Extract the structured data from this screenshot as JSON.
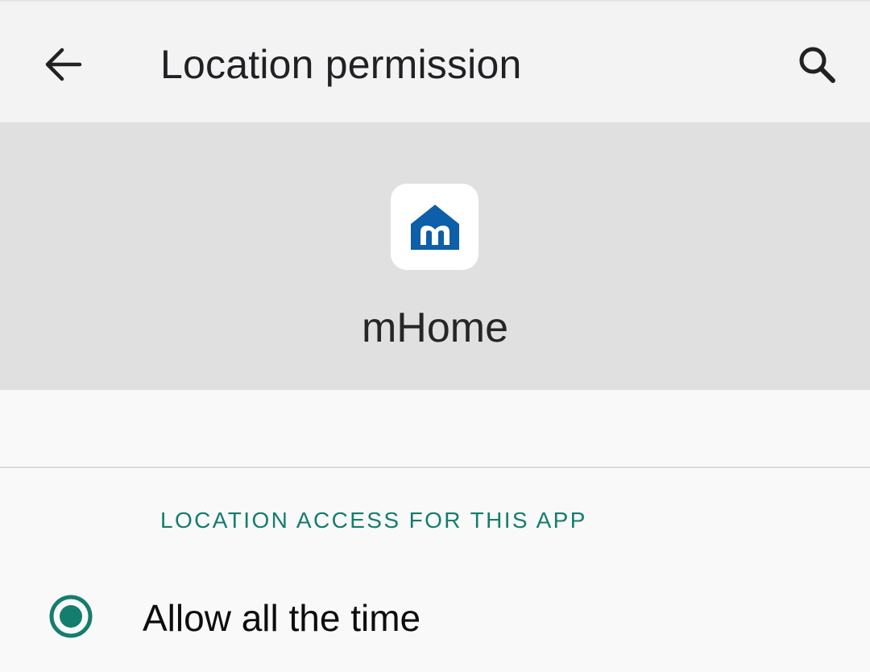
{
  "app_bar": {
    "back_icon": "arrow-back-icon",
    "title": "Location permission",
    "search_icon": "search-icon"
  },
  "app_header": {
    "icon": "mhome-logo-icon",
    "app_name": "mHome",
    "icon_color": "#0c5fa8"
  },
  "section": {
    "header": "LOCATION ACCESS FOR THIS APP"
  },
  "options": [
    {
      "label": "Allow all the time",
      "selected": true
    }
  ],
  "colors": {
    "accent": "#147d6e"
  }
}
